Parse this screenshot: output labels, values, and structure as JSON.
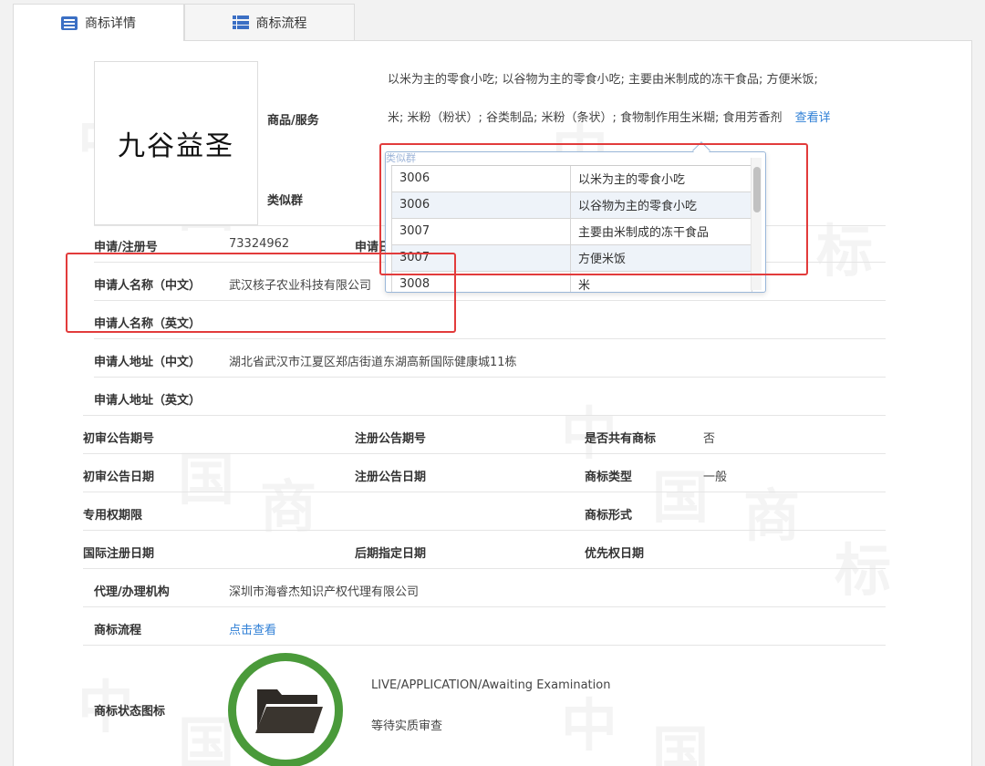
{
  "tabs": [
    {
      "label": "商标详情",
      "active": true
    },
    {
      "label": "商标流程",
      "active": false
    }
  ],
  "watermark": [
    "中",
    "国",
    "商",
    "标"
  ],
  "logo": {
    "text": "九谷益圣"
  },
  "goods_services": {
    "label": "商品/服务",
    "line1": "以米为主的零食小吃; 以谷物为主的零食小吃; 主要由米制成的冻干食品; 方便米饭;",
    "line2": "米; 米粉（粉状）; 谷类制品; 米粉（条状）; 食物制作用生米糊; 食用芳香剂",
    "more_link": "查看详"
  },
  "similar_group": {
    "label": "类似群"
  },
  "popup": {
    "header_hint": "类似群",
    "rows": [
      {
        "code": "3006",
        "name": "以米为主的零食小吃"
      },
      {
        "code": "3006",
        "name": "以谷物为主的零食小吃"
      },
      {
        "code": "3007",
        "name": "主要由米制成的冻干食品"
      },
      {
        "code": "3007",
        "name": "方便米饭"
      },
      {
        "code": "3008",
        "name": "米"
      }
    ]
  },
  "fields": {
    "reg_no": {
      "label": "申请/注册号",
      "value": "73324962"
    },
    "reg_date": {
      "label": "申请日期",
      "value": ""
    },
    "applicant_cn": {
      "label": "申请人名称（中文）",
      "value": "武汉核子农业科技有限公司"
    },
    "applicant_en": {
      "label": "申请人名称（英文）",
      "value": ""
    },
    "address_cn": {
      "label": "申请人地址（中文）",
      "value": "湖北省武汉市江夏区郑店街道东湖高新国际健康城11栋"
    },
    "address_en": {
      "label": "申请人地址（英文）",
      "value": ""
    },
    "prelim_issue": {
      "label": "初审公告期号",
      "value": ""
    },
    "reg_issue": {
      "label": "注册公告期号",
      "value": ""
    },
    "shared": {
      "label": "是否共有商标",
      "value": "否"
    },
    "prelim_date": {
      "label": "初审公告日期",
      "value": ""
    },
    "reg_pub_date": {
      "label": "注册公告日期",
      "value": ""
    },
    "tm_type": {
      "label": "商标类型",
      "value": "一般"
    },
    "exclusive_period": {
      "label": "专用权期限",
      "value": ""
    },
    "tm_form": {
      "label": "商标形式",
      "value": ""
    },
    "intl_reg_date": {
      "label": "国际注册日期",
      "value": ""
    },
    "later_designation": {
      "label": "后期指定日期",
      "value": ""
    },
    "priority_date": {
      "label": "优先权日期",
      "value": ""
    },
    "agent": {
      "label": "代理/办理机构",
      "value": "深圳市海睿杰知识产权代理有限公司"
    },
    "flow": {
      "label": "商标流程",
      "link": "点击查看"
    },
    "status": {
      "label": "商标状态图标",
      "en": "LIVE/APPLICATION/Awaiting Examination",
      "cn": "等待实质审查"
    }
  },
  "colors": {
    "accent": "#2f7fd6",
    "highlight": "#e23b3b",
    "status_ring": "#4a9a3a",
    "tab_icon": "#3b6fc4"
  }
}
